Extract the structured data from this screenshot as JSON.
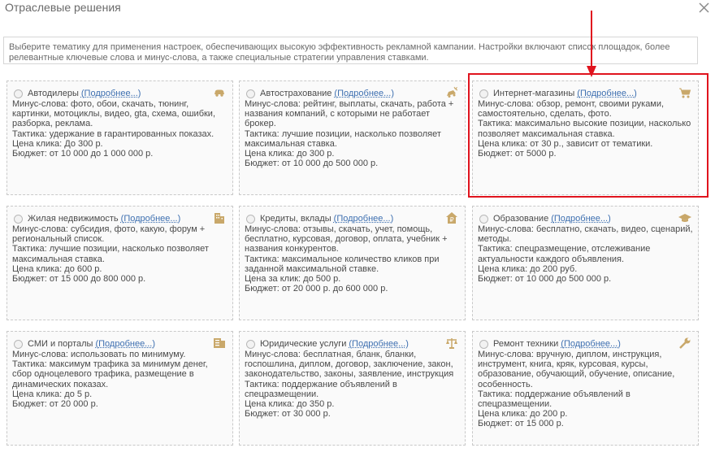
{
  "header": {
    "title": "Отраслевые решения",
    "close_icon": "close-icon"
  },
  "intro": {
    "line1": "Выберите тематику для применения настроек, обеспечивающих высокую эффективность рекламной кампании. Настройки включают список площадок, более",
    "line2": "релевантные ключевые слова и минус-слова, а также специальные стратегии управления ставками."
  },
  "more_label": "Подробнее...",
  "colors": {
    "accent_icon": "#c9a86a",
    "link": "#3d6fb0",
    "highlight": "#e0141e"
  },
  "cards": [
    {
      "title": "Автодилеры",
      "icon": "car-icon",
      "lines": [
        "Минус-слова: фото, обои, скачать, тюнинг,",
        "картинки, мотоциклы, видео, gta, схема, ошибки,",
        "разборка, реклама.",
        "Тактика: удержание в гарантированных показах.",
        "Цена клика: До 300 р.",
        "Бюджет: от 10 000 до 1 000 000 р.",
        ""
      ]
    },
    {
      "title": "Автострахование",
      "icon": "car-crash-icon",
      "lines": [
        "Минус-слова: рейтинг, выплаты, скачать, работа +",
        "названия компаний, с которыми не работает",
        "брокер.",
        "Тактика: лучшие позиции, насколько позволяет",
        "максимальная ставка.",
        "Цена клика: до 300 р.",
        "Бюджет: от 10 000 до 500 000 р."
      ]
    },
    {
      "title": "Интернет-магазины",
      "icon": "cart-icon",
      "lines": [
        "Минус-слова: обзор, ремонт, своими руками,",
        "самостоятельно, сделать, фото.",
        "Тактика: максимально высокие позиции, насколько",
        "позволяет максимальная ставка.",
        "Цена клика: от 30 р., зависит от тематики.",
        "Бюджет: от 5000 р.",
        ""
      ]
    },
    {
      "title": "Жилая недвижимость",
      "icon": "building-icon",
      "lines": [
        "Минус-слова: субсидия, фото, какую, форум +",
        "региональный список.",
        "Тактика: лучшие позиции, насколько позволяет",
        "максимальная ставка.",
        "Цена клика: до 600 р.",
        "Бюджет: от 15 000 до 800 000 р.",
        ""
      ]
    },
    {
      "title": "Кредиты, вклады",
      "icon": "ruble-house-icon",
      "lines": [
        "Минус-слова: отзывы, скачать, учет, помощь,",
        "бесплатно, курсовая, договор, оплата, учебник +",
        "названия конкурентов.",
        "Тактика: максимальное количество кликов при",
        "заданной максимальной ставке.",
        "Цена за клик: до 500 р.",
        "Бюджет: от 20 000 р. до 600 000 р."
      ]
    },
    {
      "title": "Образование",
      "icon": "graduation-cap-icon",
      "lines": [
        "Минус-слова: бесплатно, скачать, видео, сценарий,",
        "методы.",
        "Тактика: спецразмещение, отслеживание",
        "актуальности каждого объявления.",
        "Цена клика: до 200 руб.",
        "Бюджет: от 10 000 до 500 000 р.",
        ""
      ]
    },
    {
      "title": "СМИ и порталы",
      "icon": "newspaper-icon",
      "lines": [
        "Минус-слова: использовать по минимуму.",
        "Тактика: максимум трафика за минимум денег,",
        "сбор одноцелевого трафика, размещение в",
        "динамических показах.",
        "Цена клика: до 5 р.",
        "Бюджет: от 20 000 р.",
        ""
      ]
    },
    {
      "title": "Юридические услуги",
      "icon": "scales-icon",
      "lines": [
        "Минус-слова: бесплатная, бланк, бланки,",
        "госпошлина, диплом, договор, заключение, закон,",
        "законодательство, законы, заявление, инструкция",
        "Тактика: поддержание объявлений в",
        "спецразмещении.",
        "Цена клика: до 350 р.",
        "Бюджет: от 30 000 р."
      ]
    },
    {
      "title": "Ремонт техники",
      "icon": "wrench-icon",
      "lines": [
        "Минус-слова: вручную, диплом, инструкция,",
        "инструмент, книга, кряк, курсовая, курсы,",
        "образование, обучающий, обучение, описание,",
        "особенность.",
        "Тактика: поддержание объявлений в",
        "спецразмещении.",
        "Цена клика: до 200 р.",
        "Бюджет: от 15 000 р."
      ]
    }
  ]
}
